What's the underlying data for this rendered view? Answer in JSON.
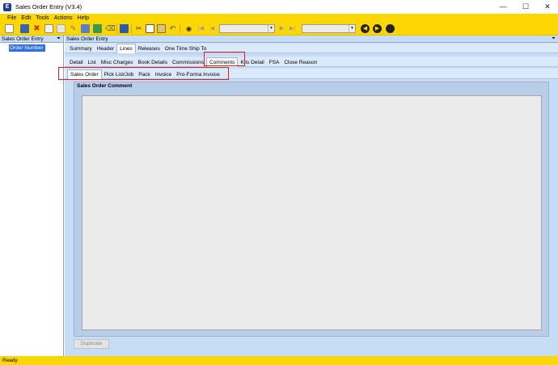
{
  "window": {
    "title": "Sales Order Entry (V3.4)"
  },
  "menu": [
    "File",
    "Edit",
    "Tools",
    "Actions",
    "Help"
  ],
  "toolbar": {
    "combo1_value": "",
    "combo2_value": ""
  },
  "left_panel": {
    "title": "Sales Order Entry",
    "tree_item": "Order Number"
  },
  "main_panel": {
    "title": "Sales Order Entry"
  },
  "tabs_row1": [
    "Summary",
    "Header",
    "Lines",
    "Releases",
    "One Time Ship To"
  ],
  "tabs_row2": [
    "Detail",
    "List",
    "Misc Charges",
    "Book Details",
    "Commissions",
    "Comments",
    "Kits Detail",
    "FSA",
    "Close Reason"
  ],
  "tabs_row3": [
    "Sales Order",
    "Pick List/Job",
    "Pack",
    "Invoice",
    "Pro-Forma Invoice"
  ],
  "group": {
    "title": "Sales Order Comment",
    "comment_text": ""
  },
  "buttons": {
    "duplicate": "Duplicate"
  },
  "status": {
    "text": "Ready"
  },
  "colors": {
    "accent": "#ffd700",
    "panel": "#c7dcf5",
    "selection": "#2f6fe0",
    "highlight": "#e02020"
  }
}
